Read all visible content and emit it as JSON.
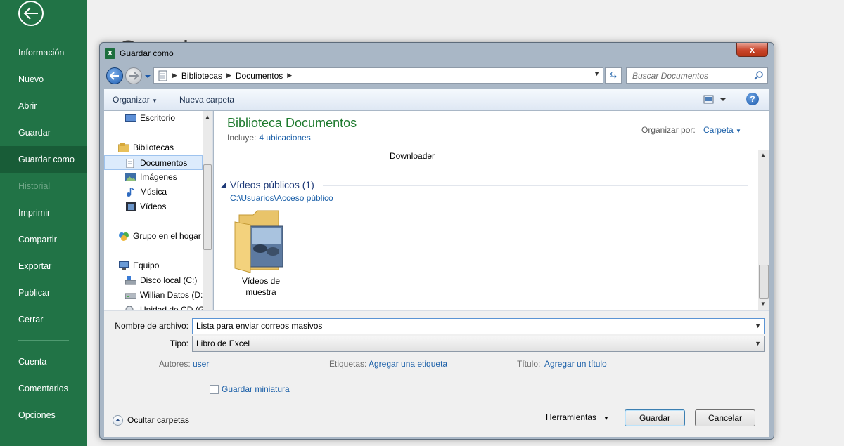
{
  "sidebar": {
    "items": [
      {
        "label": "Información"
      },
      {
        "label": "Nuevo"
      },
      {
        "label": "Abrir"
      },
      {
        "label": "Guardar"
      },
      {
        "label": "Guardar como"
      },
      {
        "label": "Historial"
      },
      {
        "label": "Imprimir"
      },
      {
        "label": "Compartir"
      },
      {
        "label": "Exportar"
      },
      {
        "label": "Publicar"
      },
      {
        "label": "Cerrar"
      },
      {
        "label": "Cuenta"
      },
      {
        "label": "Comentarios"
      },
      {
        "label": "Opciones"
      }
    ],
    "active_label": "Guardar como",
    "disabled_label": "Historial",
    "color": "#217346"
  },
  "background": {
    "title": "Guardar como"
  },
  "dialog": {
    "title": "Guardar como",
    "close_label": "x",
    "breadcrumb": [
      "Bibliotecas",
      "Documentos"
    ],
    "search_placeholder": "Buscar Documentos",
    "toolbar": {
      "organize": "Organizar",
      "new_folder": "Nueva carpeta",
      "help": "?"
    },
    "nav_pane": {
      "items": [
        {
          "label": "Escritorio",
          "icon": "desktop-icon"
        },
        {
          "label": "Bibliotecas",
          "icon": "library-icon"
        },
        {
          "label": "Documentos",
          "icon": "document-icon"
        },
        {
          "label": "Imágenes",
          "icon": "pictures-icon"
        },
        {
          "label": "Música",
          "icon": "music-icon"
        },
        {
          "label": "Vídeos",
          "icon": "videos-icon"
        },
        {
          "label": "Grupo en el hogar",
          "icon": "homegroup-icon"
        },
        {
          "label": "Equipo",
          "icon": "computer-icon"
        },
        {
          "label": "Disco local (C:)",
          "icon": "drive-icon"
        },
        {
          "label": "Willian Datos (D:",
          "icon": "drive-icon"
        },
        {
          "label": "Unidad de CD (G",
          "icon": "cd-drive-icon"
        }
      ],
      "selected": "Documentos"
    },
    "content": {
      "library_title": "Biblioteca Documentos",
      "includes_label": "Incluye:",
      "includes_link": "4 ubicaciones",
      "arrange_label": "Organizar por:",
      "arrange_value": "Carpeta",
      "partial_item": "Downloader",
      "group_title": "Vídeos públicos (1)",
      "group_path": "C:\\Usuarios\\Acceso público",
      "folder_name_line1": "Vídeos de",
      "folder_name_line2": "muestra"
    },
    "form": {
      "filename_label": "Nombre de archivo:",
      "filename_value": "Lista para enviar correos masivos",
      "type_label": "Tipo:",
      "type_value": "Libro de Excel",
      "authors_label": "Autores:",
      "authors_value": "user",
      "tags_label": "Etiquetas:",
      "tags_value": "Agregar una etiqueta",
      "title_label": "Título:",
      "title_value": "Agregar un título",
      "thumbnail_label": "Guardar miniatura",
      "thumbnail_checked": false
    },
    "footer": {
      "hide_folders": "Ocultar carpetas",
      "tools": "Herramientas",
      "save": "Guardar",
      "cancel": "Cancelar"
    }
  }
}
